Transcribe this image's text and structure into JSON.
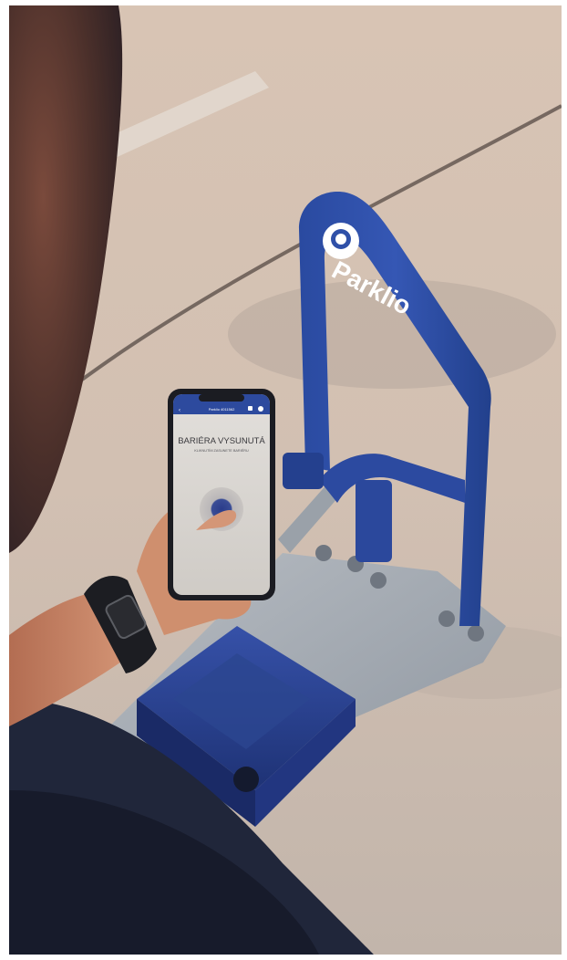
{
  "scene": {
    "colors": {
      "pavement": "#d3c1b3",
      "barrier_blue": "#2c4fa3",
      "barrier_dark": "#1e3a86",
      "metal_plate": "#aab2bb",
      "skin": "#c98a6a",
      "shirt": "#22283e",
      "phone_screen": "#d6d3cf"
    },
    "barrier_logo": {
      "brand": "Parklio",
      "icon": "parklio-logo-icon"
    },
    "phone": {
      "header_title": "Parklio 4011562",
      "status_title": "BARIÉRA VYSUNUTÁ",
      "status_subtitle": "KLIKNUTÍM ZASUNETE BARIÉRU",
      "icons": [
        "back-icon",
        "lock-icon",
        "gear-icon"
      ]
    }
  }
}
